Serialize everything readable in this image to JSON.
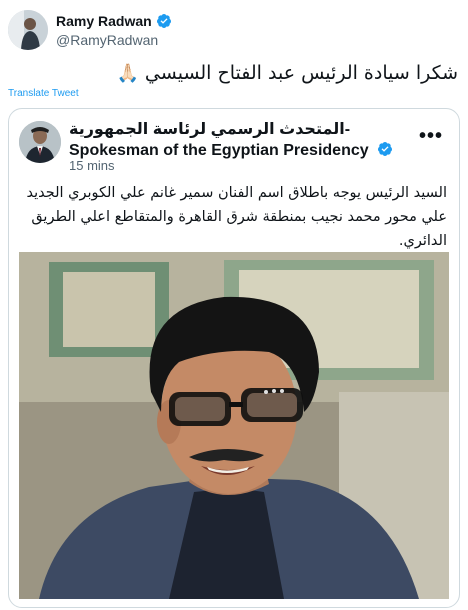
{
  "tweet": {
    "display_name": "Ramy Radwan",
    "handle": "@RamyRadwan",
    "text": "شكرا سيادة الرئيس عبد الفتاح السيسي",
    "emoji": "🙏🏻",
    "translate_label": "Translate Tweet"
  },
  "quoted": {
    "name": "المتحدث الرسمي لرئاسة الجمهورية-Spokesman of the Egyptian Presidency",
    "time": "15 mins",
    "more_icon": "more-dots-icon",
    "text": "السيد الرئيس يوجه باطلاق اسم الفنان سمير غانم علي الكوبري الجديد علي محور محمد نجيب بمنطقة شرق القاهرة والمتقاطع اعلي الطريق الدائري."
  },
  "colors": {
    "verified": "#1d9bf0",
    "link": "#1d9bf0",
    "secondary": "#536471",
    "border": "#cfd9de"
  }
}
